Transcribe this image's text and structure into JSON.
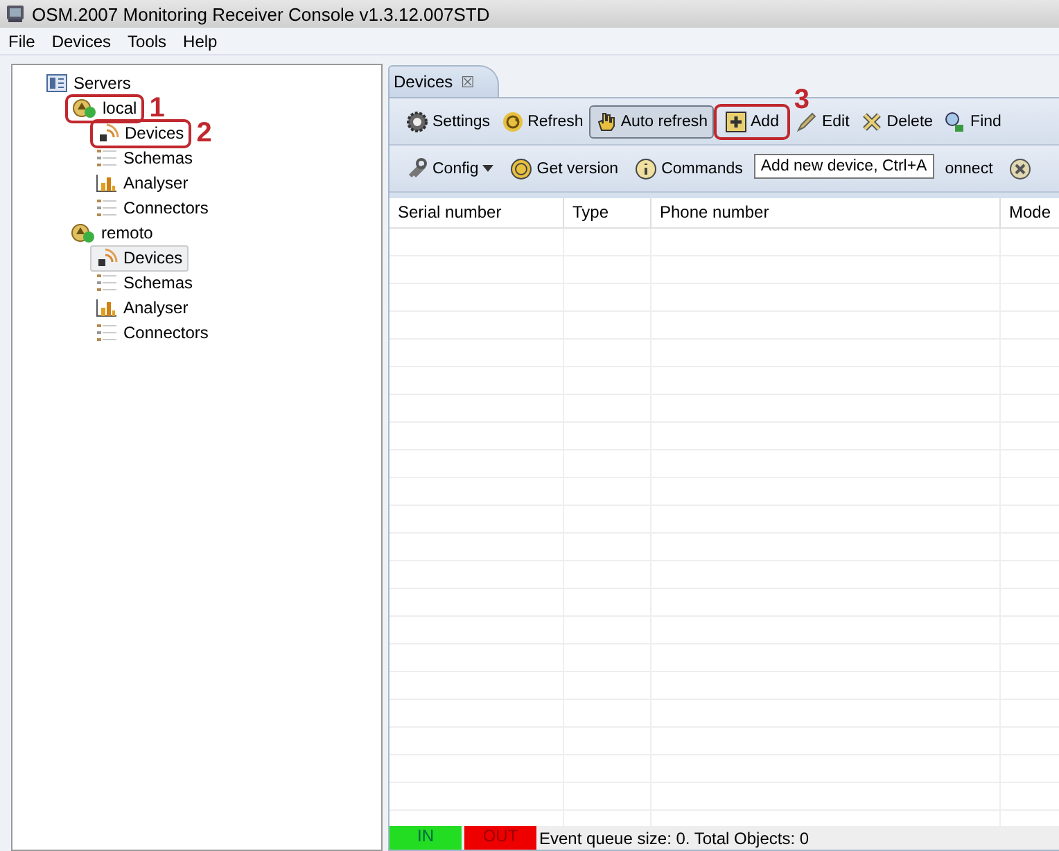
{
  "window": {
    "title": "OSM.2007 Monitoring Receiver Console v1.3.12.007STD"
  },
  "menu": [
    "File",
    "Devices",
    "Tools",
    "Help"
  ],
  "tree": [
    {
      "label": "Servers",
      "kind": "servers",
      "selected": false,
      "children": [
        {
          "label": "local",
          "kind": "server",
          "selected": false,
          "callout": "1",
          "children": [
            {
              "label": "Devices",
              "kind": "devices",
              "selected": false,
              "callout": "2"
            },
            {
              "label": "Schemas",
              "kind": "schemas",
              "selected": false
            },
            {
              "label": "Analyser",
              "kind": "analyser",
              "selected": false
            },
            {
              "label": "Connectors",
              "kind": "connectors",
              "selected": false
            }
          ]
        },
        {
          "label": "remoto",
          "kind": "server",
          "selected": false,
          "children": [
            {
              "label": "Devices",
              "kind": "devices",
              "selected": true
            },
            {
              "label": "Schemas",
              "kind": "schemas",
              "selected": false
            },
            {
              "label": "Analyser",
              "kind": "analyser",
              "selected": false
            },
            {
              "label": "Connectors",
              "kind": "connectors",
              "selected": false
            }
          ]
        }
      ]
    }
  ],
  "editor_tab": {
    "label": "Devices",
    "close": "☒"
  },
  "toolbar_1": [
    {
      "label": "Settings",
      "kind": "settings",
      "pressed": false
    },
    {
      "label": "Refresh",
      "kind": "refresh",
      "pressed": false
    },
    {
      "label": "Auto refresh",
      "kind": "hand",
      "pressed": true
    },
    {
      "label": "Add",
      "kind": "add",
      "pressed": false,
      "callout": "3"
    },
    {
      "label": "Edit",
      "kind": "edit",
      "pressed": false
    },
    {
      "label": "Delete",
      "kind": "delete",
      "pressed": false
    },
    {
      "label": "Find",
      "kind": "find",
      "pressed": false
    }
  ],
  "toolbar_2": [
    {
      "label": "Config",
      "kind": "config",
      "dropdown": true
    },
    {
      "label": "Get version",
      "kind": "question",
      "dropdown": false
    },
    {
      "label": "Commands",
      "kind": "info",
      "dropdown": false
    },
    {
      "label": "onnect",
      "kind": "none",
      "dropdown": false
    },
    {
      "kind": "stop",
      "dropdown": false
    }
  ],
  "tooltip": "Add new device, Ctrl+A",
  "table": {
    "columns": [
      "Serial number",
      "Type",
      "Phone number",
      "Mode"
    ]
  },
  "status_bar": {
    "in": "IN",
    "out": "OUT",
    "text": "Event queue size: 0.  Total Objects: 0"
  }
}
